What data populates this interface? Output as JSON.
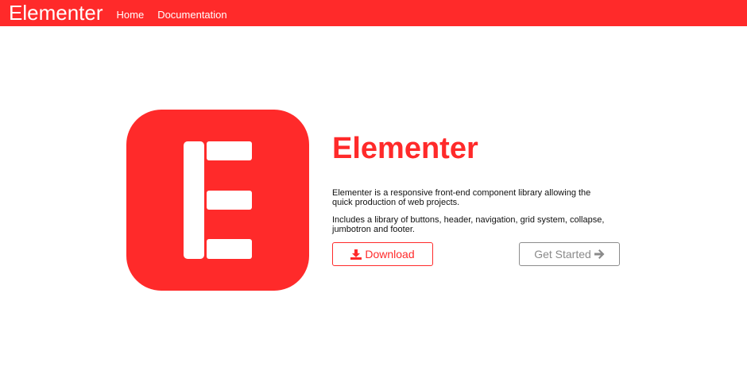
{
  "navbar": {
    "brand": "Elementer",
    "links": [
      "Home",
      "Documentation"
    ]
  },
  "logo": {
    "icon": "elementer-logo-icon"
  },
  "hero": {
    "title": "Elementer",
    "description_1": "Elementer is a responsive front-end component library allowing the quick production of web projects.",
    "description_2": "Includes a library of buttons, header, navigation, grid system, collapse, jumbotron and footer.",
    "download_label": "Download",
    "download_icon": "download-icon",
    "get_started_label": "Get Started",
    "get_started_icon": "arrow-right-icon"
  },
  "colors": {
    "accent": "#ff2a2a",
    "muted": "#8a8a8a"
  }
}
